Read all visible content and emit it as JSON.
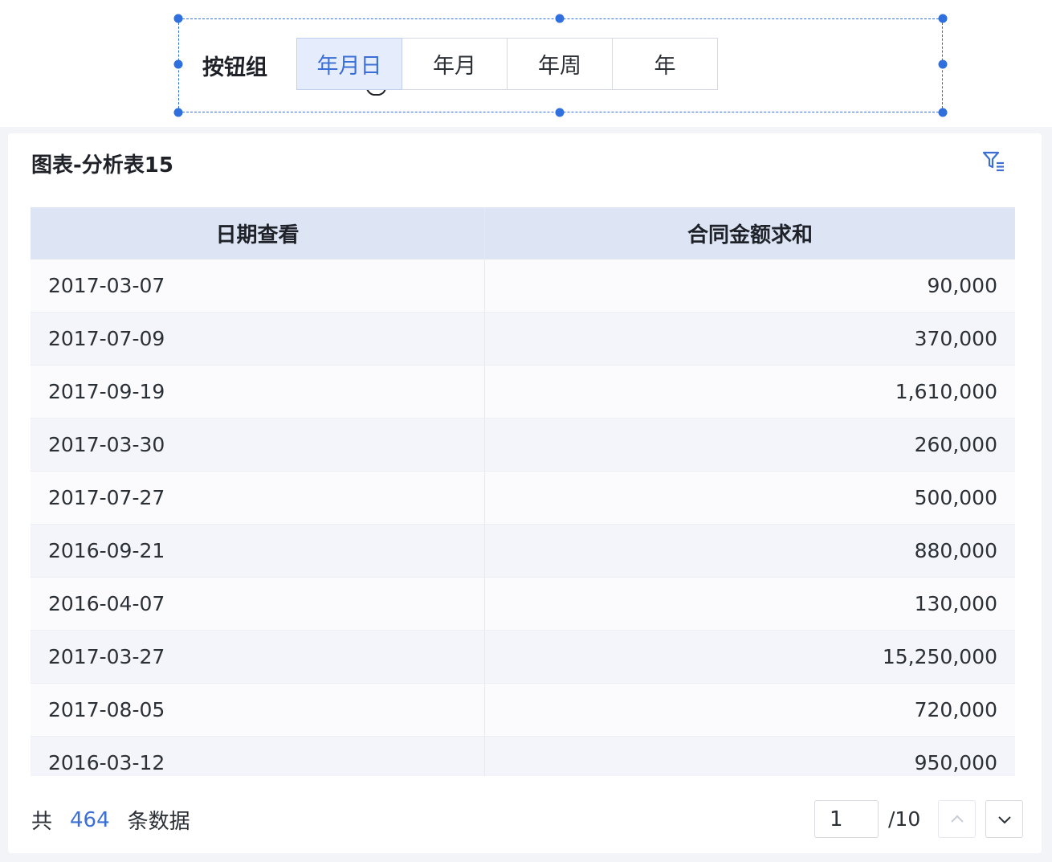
{
  "button_group": {
    "label": "按钮组",
    "buttons": [
      {
        "label": "年月日",
        "active": true
      },
      {
        "label": "年月",
        "active": false
      },
      {
        "label": "年周",
        "active": false
      },
      {
        "label": "年",
        "active": false
      }
    ]
  },
  "card": {
    "title": "图表-分析表15",
    "filter_icon": "filter-icon"
  },
  "table": {
    "headers": [
      "日期查看",
      "合同金额求和"
    ],
    "rows": [
      [
        "2017-03-07",
        "90,000"
      ],
      [
        "2017-07-09",
        "370,000"
      ],
      [
        "2017-09-19",
        "1,610,000"
      ],
      [
        "2017-03-30",
        "260,000"
      ],
      [
        "2017-07-27",
        "500,000"
      ],
      [
        "2016-09-21",
        "880,000"
      ],
      [
        "2016-04-07",
        "130,000"
      ],
      [
        "2017-03-27",
        "15,250,000"
      ],
      [
        "2017-08-05",
        "720,000"
      ],
      [
        "2016-03-12",
        "950,000"
      ]
    ]
  },
  "footer": {
    "prefix": "共",
    "count": "464",
    "suffix": "条数据",
    "page_value": "1",
    "page_total": "/10"
  },
  "colors": {
    "accent": "#3b6fd6",
    "selection": "#2f6fde",
    "header_bg": "#dde4f4"
  }
}
